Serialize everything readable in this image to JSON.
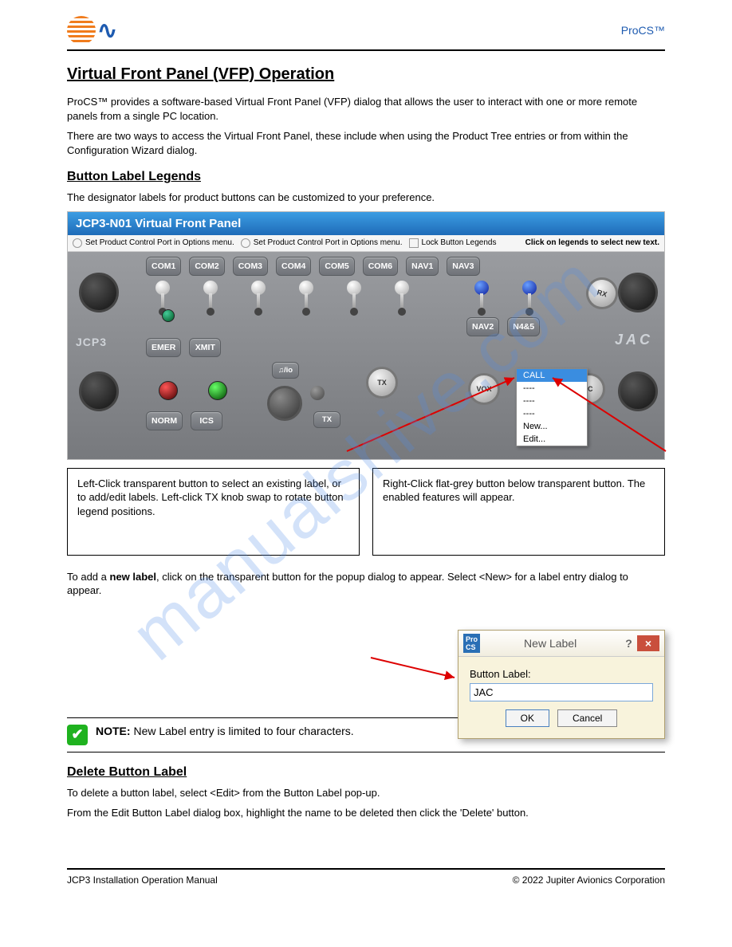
{
  "header_right": "ProCS™",
  "section_title": "Virtual Front Panel (VFP) Operation",
  "intro_p1": "ProCS™ provides a software-based Virtual Front Panel (VFP) dialog that allows the user to interact with one or more remote panels from a single PC location.",
  "intro_p2": "There are two ways to access the Virtual Front Panel, these include when using the Product Tree entries or from within the Configuration Wizard dialog.",
  "sub1": "Button Label Legends",
  "sub1_p": "The designator labels for product buttons can be customized to your preference.",
  "vfp": {
    "title": "JCP3-N01 Virtual Front Panel",
    "option1": "Set Product Control Port in Options menu.",
    "option2": "Set Product Control Port in Options menu.",
    "lock_label": "Lock Button Legends",
    "hint": "Click on legends to select new text.",
    "brand_left": "JCP3",
    "brand_right": "JAC",
    "top_buttons": [
      "COM1",
      "COM2",
      "COM3",
      "COM4",
      "COM5",
      "COM6",
      "NAV1",
      "NAV3"
    ],
    "nav_row": [
      "NAV2",
      "N4&5"
    ],
    "left2": [
      "EMER",
      "XMIT"
    ],
    "audio_btn": "♫/io",
    "tx_btn": "TX",
    "left3": [
      "NORM",
      "ICS"
    ],
    "call_label": "CALL",
    "knob_tx": "TX",
    "knob_rx": "RX",
    "knob_vox": "VOX",
    "knob_ic": "IC"
  },
  "dropdown": {
    "selected": "CALL",
    "items": [
      "CALL",
      "----",
      "----",
      "----",
      "New...",
      "Edit..."
    ]
  },
  "note_left": "Left-Click transparent button to select an existing label, or to add/edit labels. Left-click TX knob swap to rotate button legend positions.",
  "note_right": "Right-Click flat-grey button below transparent button. The enabled features will appear.",
  "new_para_1": "To add a ",
  "new_bold": "new label",
  "new_para_2": ", click on the transparent button for the popup dialog to appear. Select <New> for a label entry dialog to appear.",
  "dialog": {
    "title": "New Label",
    "label": "Button Label:",
    "value": "JAC",
    "ok": "OK",
    "cancel": "Cancel"
  },
  "note_heading": "NOTE:",
  "note_body": " New Label entry is limited to four characters.",
  "sub2": "Delete Button Label",
  "sub2_p1": "To delete a button label, select <Edit> from the Button Label pop-up.",
  "sub2_p2": "From the Edit Button Label dialog box, highlight the name to be deleted then click the 'Delete' button.",
  "footer_left": "JCP3 Installation Operation Manual",
  "footer_right": "© 2022 Jupiter Avionics Corporation",
  "watermark": "manualshive.com"
}
